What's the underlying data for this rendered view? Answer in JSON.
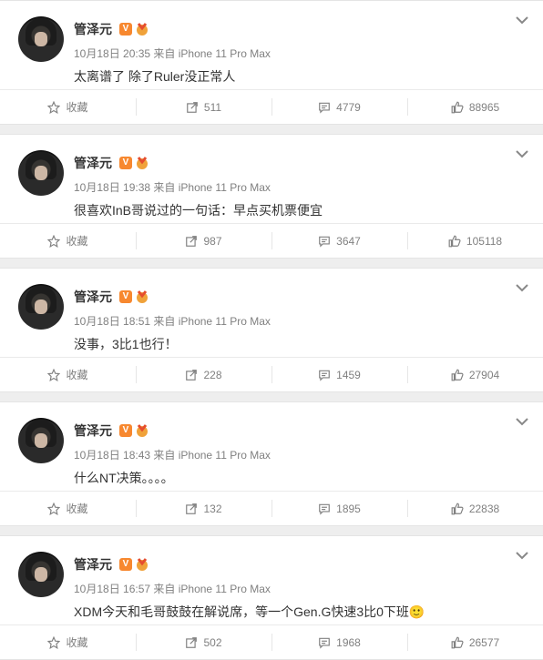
{
  "posts": [
    {
      "author": "管泽元",
      "verified_badge": "V",
      "meta": "10月18日 20:35 来自 iPhone 11 Pro Max",
      "text": "太离谱了 除了Ruler没正常人",
      "favorite_label": "收藏",
      "reposts": "511",
      "comments": "4779",
      "likes": "88965"
    },
    {
      "author": "管泽元",
      "verified_badge": "V",
      "meta": "10月18日 19:38 来自 iPhone 11 Pro Max",
      "text": "很喜欢InB哥说过的一句话：早点买机票便宜",
      "favorite_label": "收藏",
      "reposts": "987",
      "comments": "3647",
      "likes": "105118"
    },
    {
      "author": "管泽元",
      "verified_badge": "V",
      "meta": "10月18日 18:51 来自 iPhone 11 Pro Max",
      "text": "没事，3比1也行！",
      "favorite_label": "收藏",
      "reposts": "228",
      "comments": "1459",
      "likes": "27904"
    },
    {
      "author": "管泽元",
      "verified_badge": "V",
      "meta": "10月18日 18:43 来自 iPhone 11 Pro Max",
      "text": "什么NT决策。。。。",
      "favorite_label": "收藏",
      "reposts": "132",
      "comments": "1895",
      "likes": "22838"
    },
    {
      "author": "管泽元",
      "verified_badge": "V",
      "meta": "10月18日 16:57 来自 iPhone 11 Pro Max",
      "text": "XDM今天和毛哥鼓鼓在解说席，等一个Gen.G快速3比0下班🙂",
      "favorite_label": "收藏",
      "reposts": "502",
      "comments": "1968",
      "likes": "26577"
    }
  ],
  "icons": {
    "favorite": "star-outline-icon",
    "repost": "repost-icon",
    "comment": "comment-icon",
    "like": "thumbs-up-icon",
    "more": "chevron-down-icon"
  },
  "colors": {
    "badge_orange": "#f7882f",
    "meta_gray": "#808080",
    "text_dark": "#333333"
  }
}
